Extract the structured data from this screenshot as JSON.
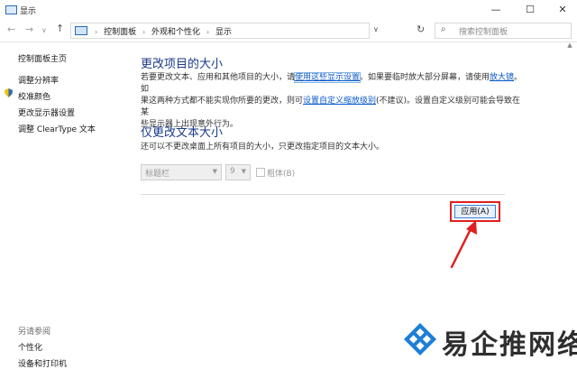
{
  "window": {
    "title": "显示",
    "icon": "display-icon",
    "controls": {
      "minimize": "—",
      "maximize": "☐",
      "close": "✕"
    }
  },
  "address_bar": {
    "back": "←",
    "forward": "→",
    "recent": "∨",
    "up": "↑",
    "breadcrumbs": [
      "控制面板",
      "外观和个性化",
      "显示"
    ],
    "separator": "›",
    "dropdown": "∨",
    "refresh": "↻",
    "search_icon": "⌕",
    "search_placeholder": "搜索控制面板"
  },
  "sidebar": {
    "items": [
      {
        "label": "控制面板主页"
      },
      {
        "label": "调整分辨率"
      },
      {
        "label": "校准颜色",
        "icon": "shield-icon"
      },
      {
        "label": "更改显示器设置"
      },
      {
        "label": "调整 ClearType 文本"
      }
    ],
    "see_also": {
      "heading": "另请参阅",
      "items": [
        {
          "label": "个性化"
        },
        {
          "label": "设备和打印机"
        }
      ]
    }
  },
  "main": {
    "section1": {
      "title": "更改项目的大小",
      "line1_pre": "若要更改文本、应用和其他项目的大小，请",
      "link1": "使用这些显示设置",
      "line1_post": "。如果要临时放大部分屏幕，请使用",
      "link2": "放大镜",
      "line1_end": "。如",
      "line2_pre": "果这两种方式都不能实现你所要的更改，则可",
      "link3": "设置自定义缩放级别",
      "line2_post": "(不建议)。设置自定义级别可能会导致在某",
      "line3": "些显示器上出现意外行为。"
    },
    "section2": {
      "title": "仅更改文本大小",
      "desc": "还可以不更改桌面上所有项目的大小，只更改指定项目的文本大小。",
      "item_select": "标题栏",
      "size_select": "9",
      "bold_label": "粗体(B)"
    },
    "apply_label": "应用(A)"
  },
  "colors": {
    "heading": "#1a3a8a",
    "link": "#0a58ca",
    "highlight": "#e02020",
    "button_border": "#3c7fd3"
  },
  "watermark": {
    "text": "易企推网络",
    "logo": "diamond-x-logo"
  }
}
